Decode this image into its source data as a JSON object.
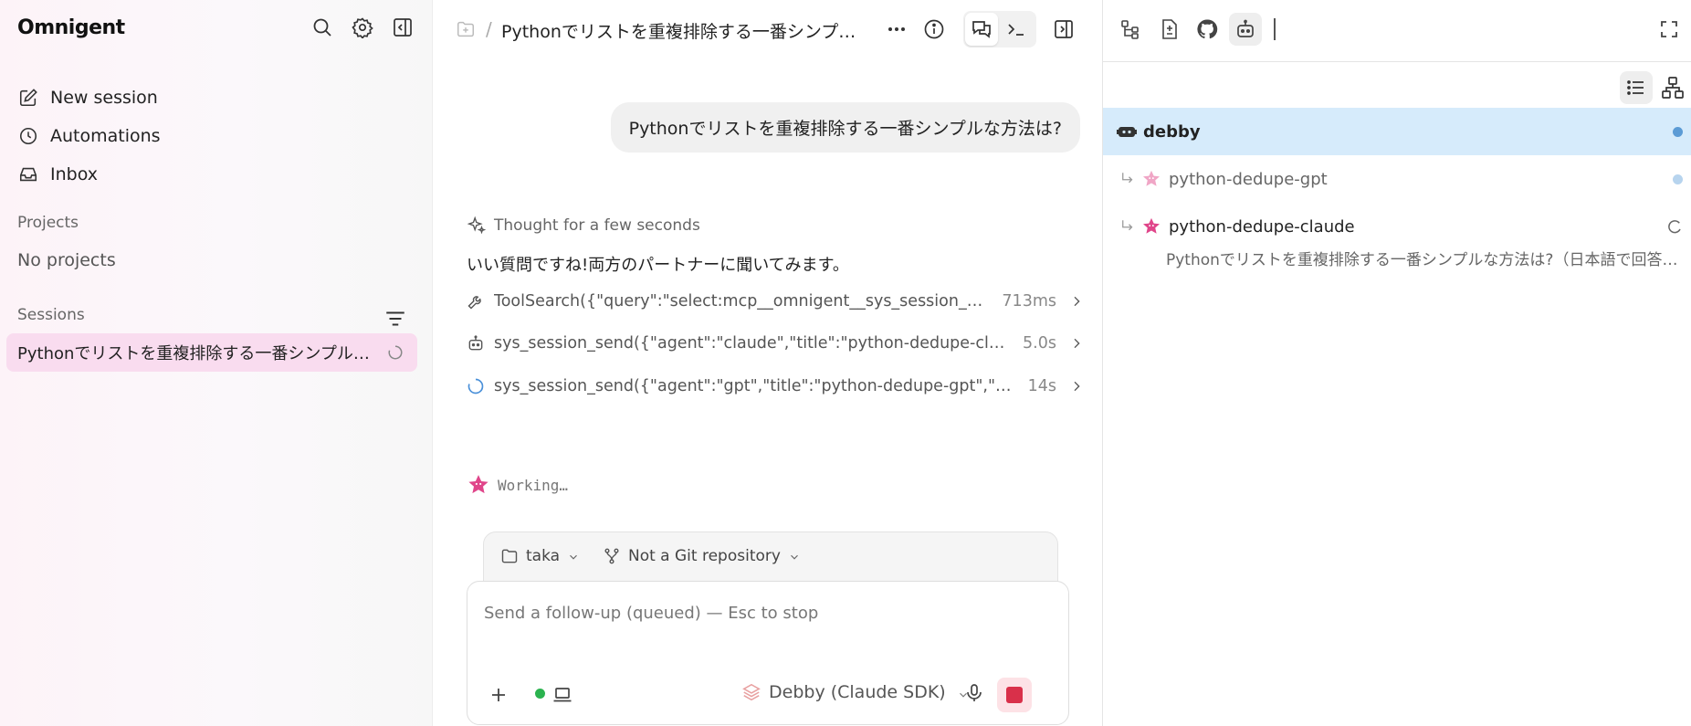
{
  "app": {
    "brand": "Omnigent"
  },
  "sidebar": {
    "nav": [
      {
        "label": "New session",
        "icon": "edit-icon"
      },
      {
        "label": "Automations",
        "icon": "clock-icon"
      },
      {
        "label": "Inbox",
        "icon": "inbox-icon"
      }
    ],
    "projects_label": "Projects",
    "no_projects": "No projects",
    "sessions_label": "Sessions",
    "sessions": [
      {
        "title": "Pythonでリストを重複排除する一番シンプルな方法は?",
        "status": "loading"
      }
    ]
  },
  "header": {
    "title": "Pythonでリストを重複排除する一番シンプルな方法は?"
  },
  "chat": {
    "user_message": "Pythonでリストを重複排除する一番シンプルな方法は?",
    "thought": "Thought for a few seconds",
    "reply": "いい質問ですね!両方のパートナーに聞いてみます。",
    "tool_calls": [
      {
        "icon": "wrench-icon",
        "text": "ToolSearch({\"query\":\"select:mcp__omnigent__sys_session_send\"})",
        "duration": "713ms"
      },
      {
        "icon": "robot-icon",
        "text": "sys_session_send({\"agent\":\"claude\",\"title\":\"python-dedupe-claude\"})",
        "duration": "5.0s"
      },
      {
        "icon": "spinner-icon",
        "text": "sys_session_send({\"agent\":\"gpt\",\"title\":\"python-dedupe-gpt\",\"args\"})",
        "duration": "14s"
      }
    ],
    "working": "Working…"
  },
  "composer": {
    "folder": "taka",
    "repo": "Not a Git repository",
    "placeholder": "Send a follow-up (queued) — Esc to stop",
    "model": "Debby (Claude SDK)",
    "status_color": "#2bb34f"
  },
  "agents_panel": {
    "items": [
      {
        "name": "debby",
        "icon": "robot-icon",
        "selected": true,
        "dot_color": "#5b9bd5"
      },
      {
        "name": "python-dedupe-gpt",
        "icon": "star-icon",
        "child": true,
        "dot_color": "#b7d4ee"
      },
      {
        "name": "python-dedupe-claude",
        "icon": "star-icon",
        "child": true,
        "subtitle": "Pythonでリストを重複排除する一番シンプルな方法は?（日本語で回答してください）"
      }
    ]
  },
  "colors": {
    "accent_pink": "#f9dcef",
    "selected_blue": "#d6ebfb",
    "stop_red": "#d9304a"
  }
}
